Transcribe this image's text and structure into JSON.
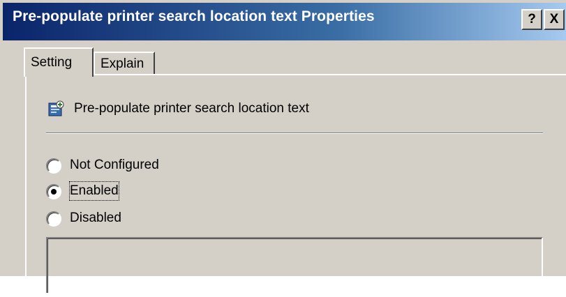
{
  "window": {
    "title": "Pre-populate printer search location text Properties",
    "help_label": "?",
    "close_label": "X"
  },
  "tabs": [
    {
      "label": "Setting",
      "selected": true
    },
    {
      "label": "Explain",
      "selected": false
    }
  ],
  "policy": {
    "icon": "policy-setting-icon",
    "name": "Pre-populate printer search location text"
  },
  "options": {
    "not_configured": "Not Configured",
    "enabled": "Enabled",
    "disabled": "Disabled",
    "selected": "enabled"
  },
  "colors": {
    "title_gradient_start": "#0a246a",
    "title_gradient_end": "#a6caf0",
    "face": "#d4d0c8"
  }
}
